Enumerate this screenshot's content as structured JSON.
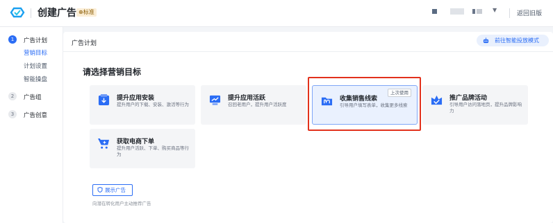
{
  "app": {
    "title": "创建广告",
    "edition_badge": "标准"
  },
  "header": {
    "back_label": "返回旧版"
  },
  "sidebar": {
    "steps": [
      {
        "num": "1",
        "label": "广告计划",
        "substeps": [
          "营销目标",
          "计划设置",
          "智能操盘"
        ]
      },
      {
        "num": "2",
        "label": "广告组"
      },
      {
        "num": "3",
        "label": "广告创意"
      }
    ]
  },
  "main": {
    "panel_title": "广告计划",
    "smart_mode_button": "前往智能投放模式",
    "section_title": "请选择营销目标",
    "cards": [
      {
        "title": "提升应用安装",
        "desc": "提升用户的下载、安装、激活等行为",
        "icon": "app-download-icon"
      },
      {
        "title": "提升应用活跃",
        "desc": "召回老用户，提升用户活跃度",
        "icon": "trend-monitor-icon"
      },
      {
        "title": "收集销售线索",
        "desc": "引导用户填写表单，收集更多线索",
        "icon": "leads-folder-icon",
        "tag": "上次使用",
        "selected": true
      },
      {
        "title": "推广品牌活动",
        "desc": "引导用户访问落地页，提升品牌影响力",
        "icon": "brand-check-icon"
      },
      {
        "title": "获取电商下单",
        "desc": "提升用户活跃、下单、购买商品等行为",
        "icon": "shopping-cart-icon"
      }
    ],
    "show_ad_button": "展示广告",
    "hint": "向潜在转化用户主动推荐广告"
  },
  "colors": {
    "primary": "#2b6df5",
    "highlight_box": "#e2311c"
  }
}
